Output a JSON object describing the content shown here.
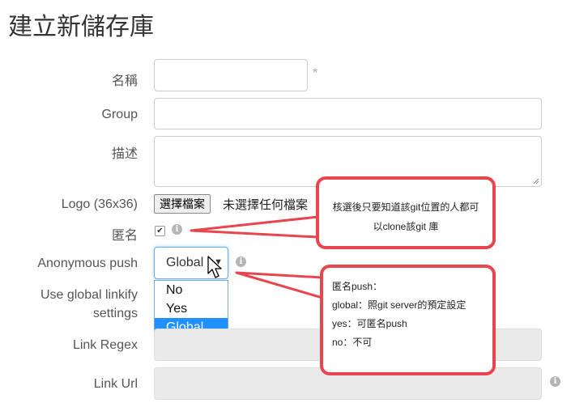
{
  "page_title": "建立新儲存庫",
  "form": {
    "name_label": "名稱",
    "required_mark": "*",
    "group_label": "Group",
    "description_label": "描述",
    "logo_label": "Logo (36x36)",
    "file_button": "選擇檔案",
    "file_status": "未選擇任何檔案",
    "anonymous_label": "匿名",
    "anonymous_checked": true,
    "anonymous_check_glyph": "✔",
    "anonymous_push_label": "Anonymous push",
    "anonymous_push_value": "Global",
    "anonymous_push_options": [
      "No",
      "Yes",
      "Global"
    ],
    "global_linkify_label_line1": "Use global linkify",
    "global_linkify_label_line2": "settings",
    "link_regex_label": "Link Regex",
    "link_url_label": "Link Url",
    "info_glyph": "i",
    "select_arrow_glyph": "▼"
  },
  "callouts": {
    "anonymous_line1": "核選後只要知道該git位置的人都可",
    "anonymous_line2": "以clone該git 庫",
    "push_lines": [
      "匿名push：",
      "global：照git server的預定設定",
      "yes：可匿名push",
      "no：不可"
    ]
  },
  "colors": {
    "callout_border": "#e8464e",
    "selected_option": "#1e90ff",
    "focus_border": "#66afe9"
  }
}
